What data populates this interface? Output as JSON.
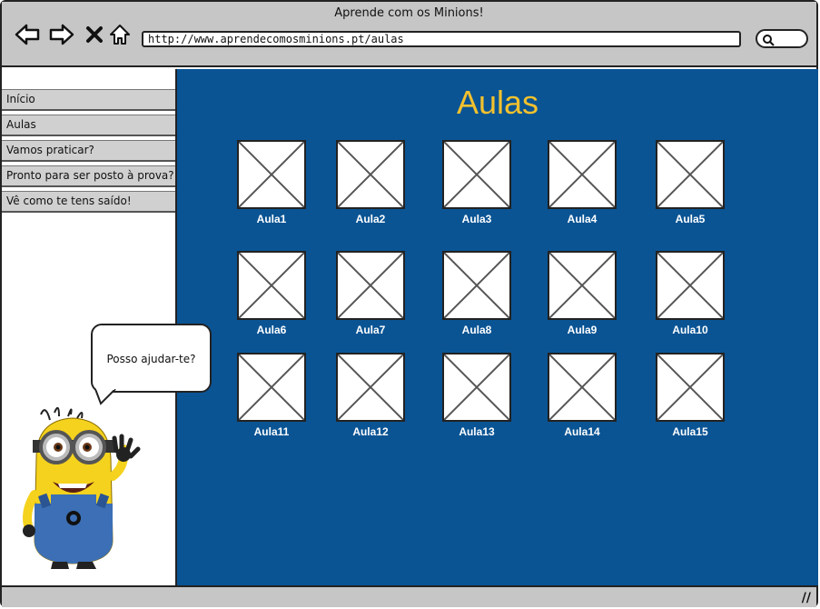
{
  "window": {
    "title": "Aprende com os Minions!"
  },
  "nav": {
    "url": "http://www.aprendecomosminions.pt/aulas"
  },
  "sidebar": {
    "items": [
      {
        "label": "Início"
      },
      {
        "label": "Aulas"
      },
      {
        "label": "Vamos praticar?"
      },
      {
        "label": "Pronto para ser posto à prova?"
      },
      {
        "label": "Vê como te tens saído!"
      }
    ]
  },
  "main": {
    "title": "Aulas",
    "lessons": [
      {
        "label": "Aula1"
      },
      {
        "label": "Aula2"
      },
      {
        "label": "Aula3"
      },
      {
        "label": "Aula4"
      },
      {
        "label": "Aula5"
      },
      {
        "label": "Aula6"
      },
      {
        "label": "Aula7"
      },
      {
        "label": "Aula8"
      },
      {
        "label": "Aula9"
      },
      {
        "label": "Aula10"
      },
      {
        "label": "Aula11"
      },
      {
        "label": "Aula12"
      },
      {
        "label": "Aula13"
      },
      {
        "label": "Aula14"
      },
      {
        "label": "Aula15"
      }
    ]
  },
  "helper": {
    "bubble_text": "Posso ajudar-te?"
  },
  "colors": {
    "content_bg": "#0a5494",
    "title_color": "#f2c12e",
    "chrome_gray": "#c6c6c6"
  }
}
